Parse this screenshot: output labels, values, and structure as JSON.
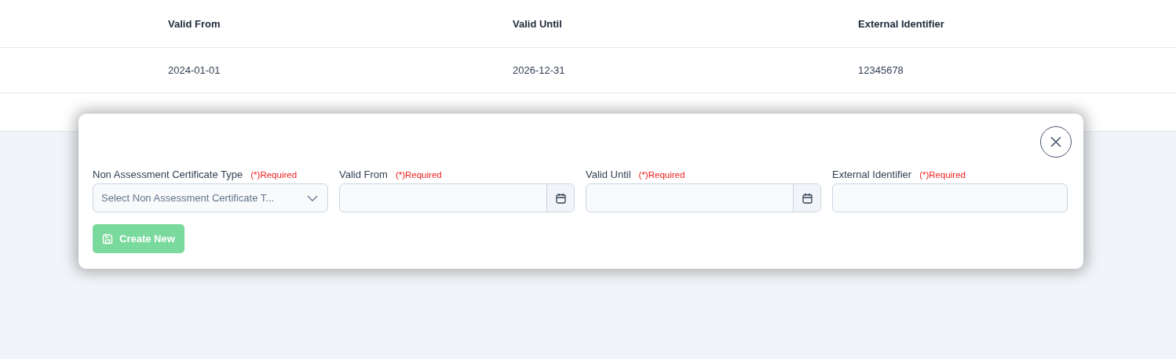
{
  "table": {
    "columns": [
      "Valid From",
      "Valid Until",
      "External Identifier"
    ],
    "rows": [
      [
        "2024-01-01",
        "2026-12-31",
        "12345678"
      ]
    ]
  },
  "dialog": {
    "fields": [
      {
        "label": "Non Assessment Certificate Type",
        "required": "(*)Required",
        "kind": "select",
        "placeholder": "Select Non Assessment Certificate T..."
      },
      {
        "label": "Valid From",
        "required": "(*)Required",
        "kind": "date"
      },
      {
        "label": "Valid Until",
        "required": "(*)Required",
        "kind": "date"
      },
      {
        "label": "External Identifier",
        "required": "(*)Required",
        "kind": "text"
      }
    ],
    "button": {
      "label": "Create New",
      "disabled": true
    }
  }
}
